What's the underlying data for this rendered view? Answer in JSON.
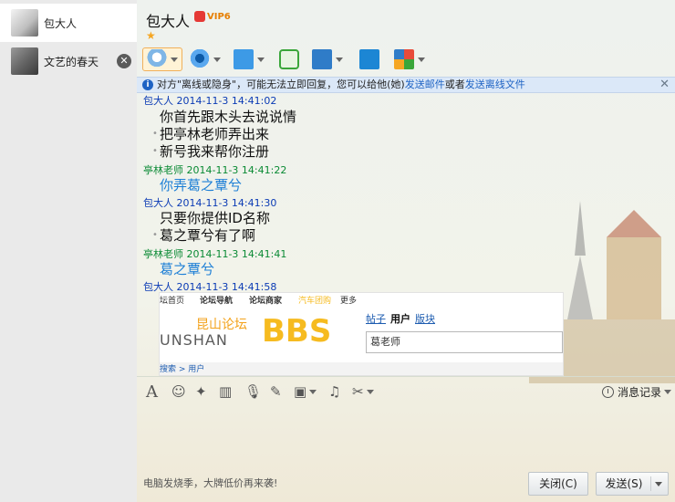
{
  "sidebar": {
    "contacts": [
      {
        "name": "包大人"
      },
      {
        "name": "文艺的春天"
      }
    ]
  },
  "header": {
    "title": "包大人",
    "vip_badge": "VIP6"
  },
  "infobar": {
    "text": "对方\"离线或隐身\"，可能无法立即回复，您可以给他(她)",
    "link_email": "发送邮件",
    "or": "或者",
    "link_offline_file": "发送离线文件"
  },
  "chat": {
    "messages": [
      {
        "sender": "包大人",
        "time": "2014-11-3 14:41:02",
        "lines": [
          "你首先跟木头去说说情",
          "把亭林老师弄出来",
          "新号我来帮你注册"
        ]
      },
      {
        "sender": "亭林老师",
        "time": "2014-11-3 14:41:22",
        "lines": [
          "你弄葛之覃兮"
        ]
      },
      {
        "sender": "包大人",
        "time": "2014-11-3 14:41:30",
        "lines": [
          "只要你提供ID名称",
          "葛之覃兮有了啊"
        ]
      },
      {
        "sender": "亭林老师",
        "time": "2014-11-3 14:41:41",
        "lines": [
          "葛之覃兮"
        ]
      },
      {
        "sender": "包大人",
        "time": "2014-11-3 14:41:58",
        "lines": []
      }
    ],
    "screenshot": {
      "nav": [
        "坛首页",
        "论坛导航",
        "论坛商家",
        "汽车团购",
        "更多"
      ],
      "logo_cn": "昆山论坛",
      "logo_en": "UNSHAN",
      "logo_bbs": "BBS",
      "tabs": [
        "帖子",
        "用户",
        "版块"
      ],
      "field_value": "葛老师",
      "breadcrumb": "搜索 > 用户"
    }
  },
  "input": {
    "history_label": "消息记录"
  },
  "footer": {
    "ad_text": "电脑发烧季，大牌低价再来袭!",
    "close_label": "关闭(C)",
    "send_label": "发送(S)"
  },
  "colors": {
    "self_name": "#0b3bb5",
    "peer_name": "#0a8a34",
    "peer_message": "#1d7fd6",
    "link": "#1e63c4",
    "infobar_bg": "#dbe8f8"
  }
}
